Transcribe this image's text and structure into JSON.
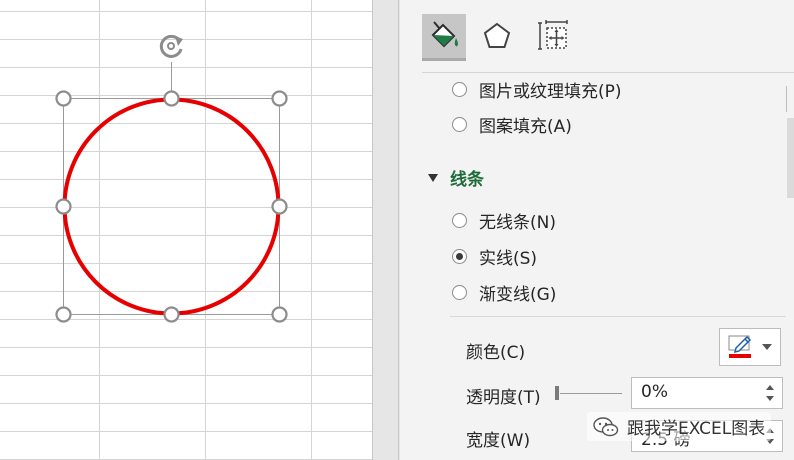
{
  "fill_options": [
    {
      "label": "图片或纹理填充(P)",
      "selected": false
    },
    {
      "label": "图案填充(A)",
      "selected": false
    }
  ],
  "line_section": {
    "title": "线条",
    "options": [
      {
        "label": "无线条(N)",
        "selected": false
      },
      {
        "label": "实线(S)",
        "selected": true
      },
      {
        "label": "渐变线(G)",
        "selected": false
      }
    ]
  },
  "properties": {
    "color_label": "颜色(C)",
    "transparency_label": "透明度(T)",
    "transparency_value": "0%",
    "width_label": "宽度(W)",
    "width_value": "2.5 磅"
  },
  "watermark_text": "跟我学EXCEL图表",
  "colors": {
    "shape_outline": "#e60000",
    "section_title": "#1e6b3a",
    "handle": "#8c8c8c",
    "active_tab": "#c6c6c6"
  },
  "icons": {
    "tab1": "paint-bucket-icon",
    "tab2": "pentagon-icon",
    "tab3": "size-properties-icon",
    "rotate": "rotate-handle-icon",
    "pen": "pen-icon",
    "watermark": "wechat-icon"
  }
}
